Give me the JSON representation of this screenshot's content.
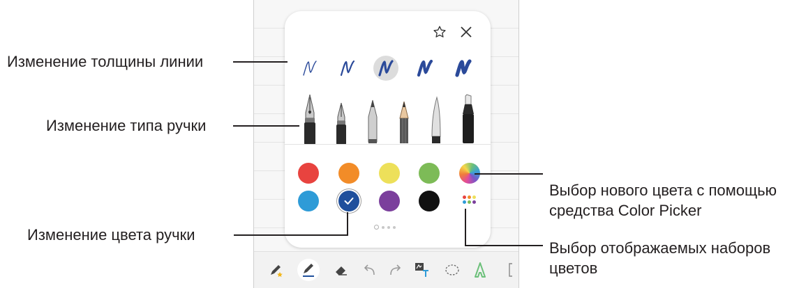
{
  "callouts": {
    "line_thickness": "Изменение толщины линии",
    "pen_type": "Изменение типа ручки",
    "pen_color": "Изменение цвета ручки",
    "color_picker_line1": "Выбор нового цвета с помощью",
    "color_picker_line2": "средства Color Picker",
    "palettes_line1": "Выбор отображаемых наборов",
    "palettes_line2": "цветов"
  },
  "pen_settings": {
    "thickness_options": 5,
    "selected_thickness_index": 2,
    "pen_types": [
      "fountain-pen",
      "calligraphy-pen",
      "ballpoint-pen",
      "pencil",
      "brush-pen",
      "marker"
    ],
    "colors": [
      {
        "name": "red",
        "hex": "#e8433f"
      },
      {
        "name": "orange",
        "hex": "#f28c28"
      },
      {
        "name": "yellow",
        "hex": "#ede05a"
      },
      {
        "name": "green",
        "hex": "#7dbb57"
      },
      {
        "name": "color-picker",
        "hex": "gradient"
      },
      {
        "name": "blue",
        "hex": "#2e9bd7"
      },
      {
        "name": "navy",
        "hex": "#1f4f9c"
      },
      {
        "name": "purple",
        "hex": "#7b3f9c"
      },
      {
        "name": "black",
        "hex": "#111111"
      }
    ],
    "selected_color": "navy",
    "pages": 4,
    "current_page": 1
  },
  "colors": {
    "stroke": "#2b4a9a",
    "accent": "#1f4f9c"
  },
  "toolbar_icons": [
    "pen-favorite-icon",
    "pen-icon",
    "eraser-icon",
    "undo-icon",
    "redo-icon",
    "text-convert-icon",
    "lasso-icon",
    "style-icon"
  ]
}
